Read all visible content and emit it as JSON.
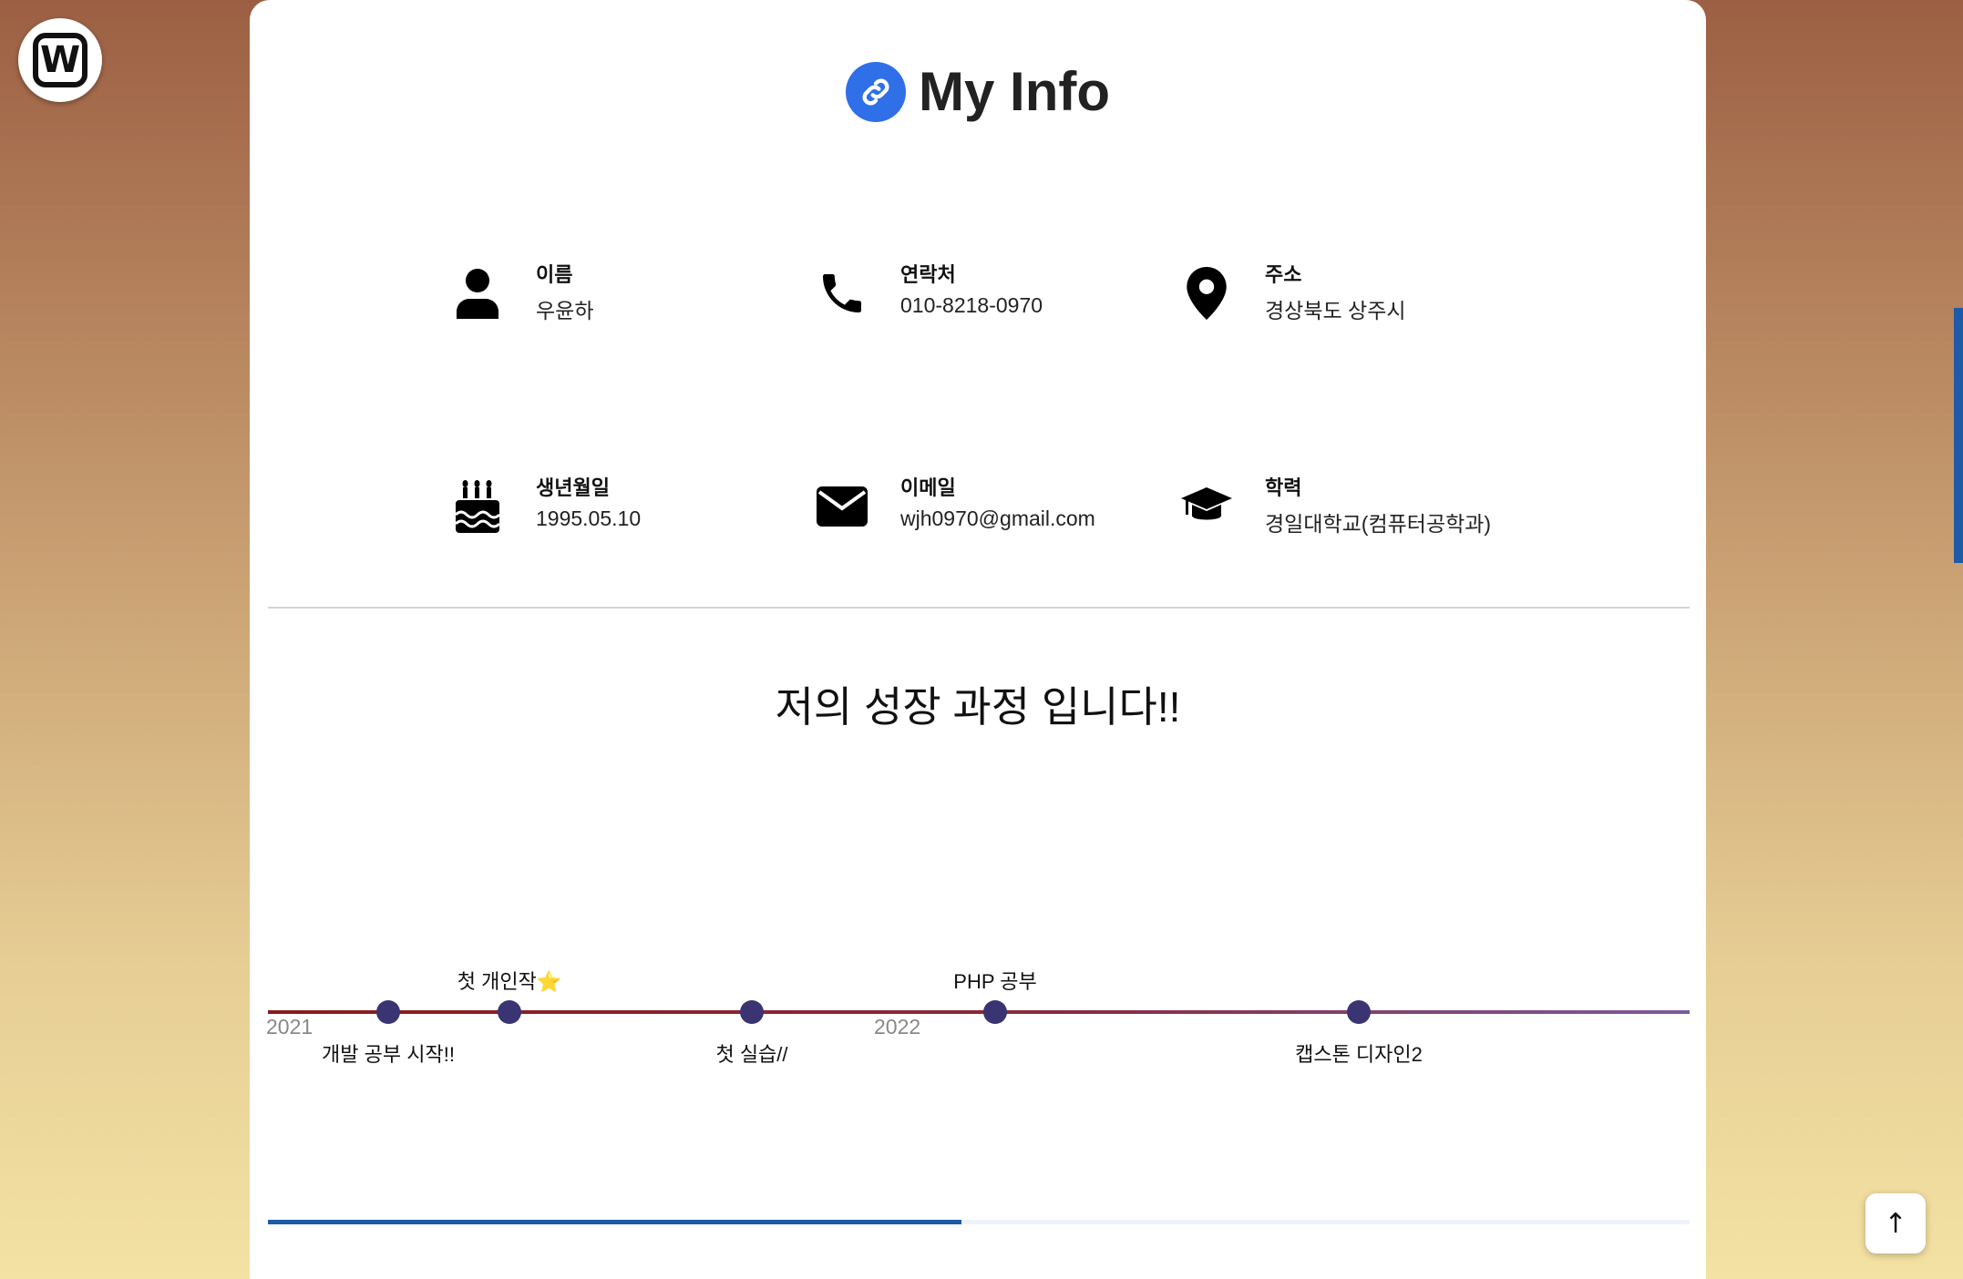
{
  "brand": {
    "logo_letter": "W"
  },
  "header": {
    "title": "My Info",
    "title_icon": "link-icon",
    "accent": "#2f6fe8"
  },
  "info": [
    {
      "label": "이름",
      "value": "우윤하",
      "icon": "person-icon"
    },
    {
      "label": "연락처",
      "value": "010-8218-0970",
      "icon": "phone-icon"
    },
    {
      "label": "주소",
      "value": "경상북도 상주시",
      "icon": "location-pin-icon"
    },
    {
      "label": "생년월일",
      "value": "1995.05.10",
      "icon": "birthday-cake-icon"
    },
    {
      "label": "이메일",
      "value": "wjh0970@gmail.com",
      "icon": "envelope-icon"
    },
    {
      "label": "학력",
      "value": "경일대학교(컴퓨터공학과)",
      "icon": "graduation-cap-icon"
    }
  ],
  "growth": {
    "title": "저의 성장 과정 입니다!!",
    "years": [
      "2021",
      "2022"
    ],
    "events": [
      {
        "label": "개발 공부 시작!!"
      },
      {
        "label": "첫 개인작⭐"
      },
      {
        "label": "첫 실습//"
      },
      {
        "label": "PHP 공부"
      },
      {
        "label": "캡스톤 디자인2"
      }
    ],
    "progress_fraction": 0.488
  },
  "scroll_top": {
    "icon": "arrow-up-icon",
    "glyph": "↑"
  }
}
